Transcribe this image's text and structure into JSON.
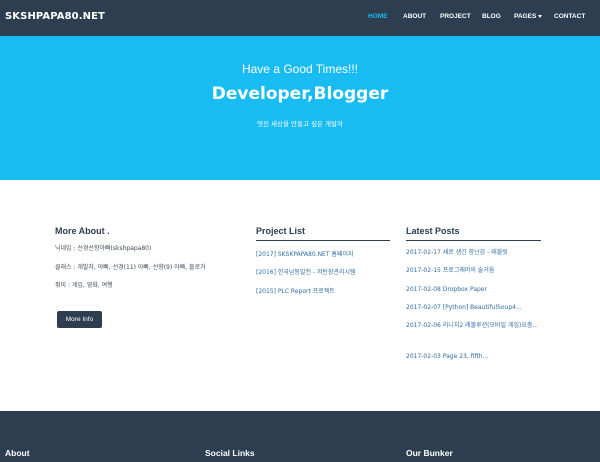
{
  "nav": {
    "brand": "SKSHPAPA80.NET",
    "items": [
      {
        "label": "HOME",
        "active": true
      },
      {
        "label": "ABOUT"
      },
      {
        "label": "PROJECT"
      },
      {
        "label": "BLOG"
      },
      {
        "label": "PAGES",
        "dropdown": true
      },
      {
        "label": "CONTACT"
      }
    ]
  },
  "hero": {
    "greeting": "Have a Good Times!!!",
    "title": "Developer,Blogger",
    "subtitle": "멋진 세상을 만들고 싶은 개발자"
  },
  "about": {
    "title": "More About .",
    "lines": [
      "닉네임 : 선경선향아빠(skshpapa80)",
      "클래스 : 개발자, 아빠, 선경(11) 아빠, 선향(9) 아빠, 블로거",
      "취미 : 게임, 영화, 여행"
    ],
    "button": "More Info"
  },
  "projects": {
    "title": "Project List",
    "items": [
      "[2017] SKSKPAPA80.NET 홈페이지",
      "[2016] 한국남동발전 - 저탄장관리시템",
      "[2015] PLC Report 프로젝트"
    ]
  },
  "posts": {
    "title": "Latest Posts",
    "items": [
      "2017-02-17 새로 생긴 장난감 - 태블릿",
      "2017-02-15 프로그래머의 술거움",
      "2017-02-08 Dropbox Paper",
      "2017-02-07 [Python] BeautifulSoup4...",
      "2017-02-06 리니지2 레볼루션(모바일 게임)요즘...",
      "2017-02-03 Page 23, fifth..."
    ]
  },
  "footer": {
    "about": "About",
    "social": "Social Links",
    "bunker": "Our Bunker"
  },
  "colors": {
    "navbar": "#2c3e50",
    "accent": "#18bcf2",
    "link": "#2e6da4"
  }
}
